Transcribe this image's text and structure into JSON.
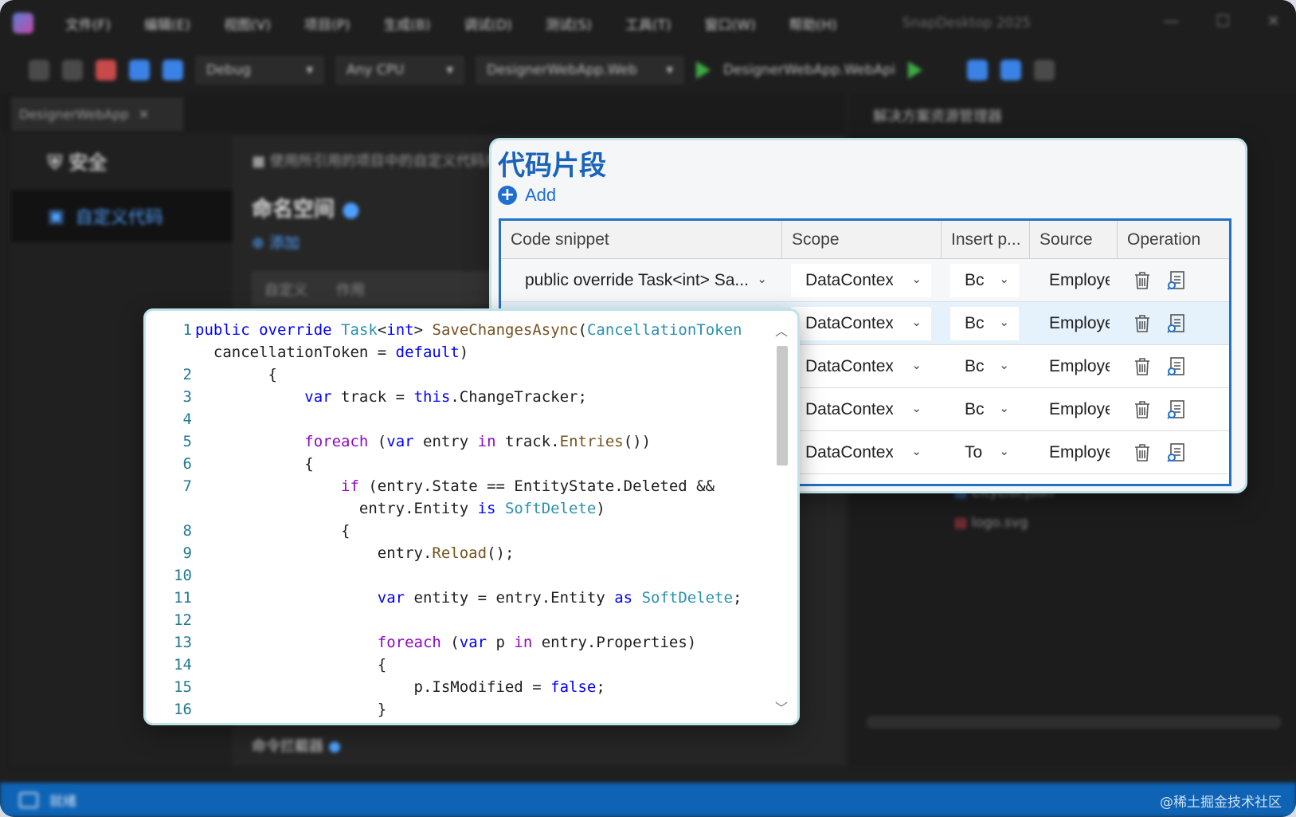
{
  "menubar": {
    "items": [
      "文件(F)",
      "编辑(E)",
      "视图(V)",
      "项目(P)",
      "生成(B)",
      "调试(D)",
      "测试(S)",
      "工具(T)",
      "窗口(W)",
      "帮助(H)"
    ],
    "search": "SnapDesktop 2025"
  },
  "toolbar": {
    "config": "Debug",
    "platform": "Any CPU",
    "project": "DesignerWebApp.Web",
    "start_target": "DesignerWebApp.WebApi"
  },
  "doc_tab": {
    "label": "DesignerWebApp"
  },
  "left_nav": {
    "header": "安全",
    "active_item": "自定义代码"
  },
  "main": {
    "notice": "使用所引用的项目中的自定义代码片段",
    "heading": "命名空间",
    "add_label": "添加",
    "col1": "自定义",
    "col2": "作用",
    "bottom_heading": "命令拦截器"
  },
  "right_panel": {
    "title": "解决方案资源管理器",
    "files": [
      "CityList.json",
      "logo.svg"
    ]
  },
  "statusbar": {
    "status": "就绪",
    "watermark": "@稀土掘金技术社区"
  },
  "snippet_panel": {
    "title": "代码片段",
    "add_label": "Add",
    "columns": {
      "snippet": "Code snippet",
      "scope": "Scope",
      "insert": "Insert p...",
      "source": "Source",
      "operation": "Operation"
    },
    "rows": [
      {
        "snippet": "public override Task<int> Sa...",
        "scope": "DataContext",
        "insert": "Bc",
        "source": "Employee"
      },
      {
        "snippet": "",
        "scope": "DataContext",
        "insert": "Bc",
        "source": "Employee"
      },
      {
        "snippet": "",
        "scope": "DataContext",
        "insert": "Bc",
        "source": "Employee"
      },
      {
        "snippet": "",
        "scope": "DataContext",
        "insert": "Bc",
        "source": "Employee"
      },
      {
        "snippet": "",
        "scope": "DataContext",
        "insert": "To",
        "source": "Employee"
      }
    ]
  },
  "code_editor": {
    "line_numbers": [
      "1",
      "",
      "2",
      "3",
      "4",
      "5",
      "6",
      "7",
      "",
      "8",
      "9",
      "10",
      "11",
      "12",
      "13",
      "14",
      "15",
      "16"
    ]
  }
}
